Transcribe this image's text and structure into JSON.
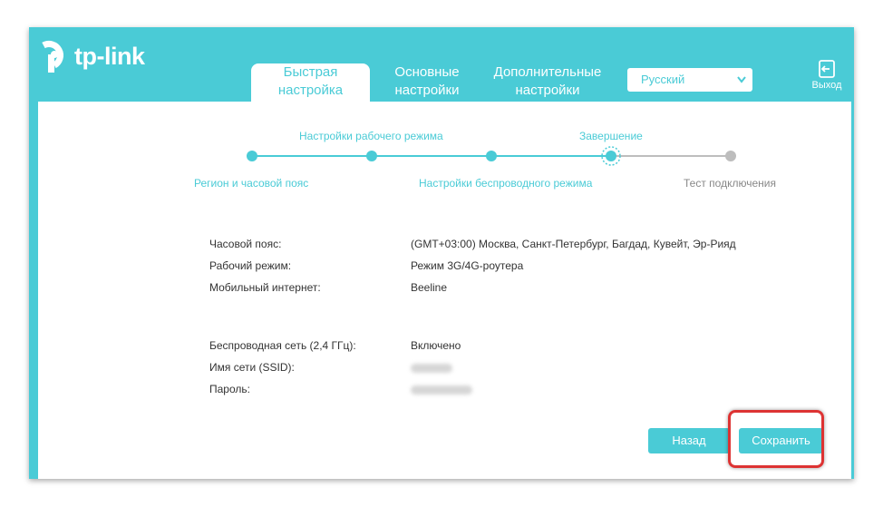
{
  "header": {
    "logo_text": "tp-link",
    "tabs": [
      {
        "line1": "Быстрая",
        "line2": "настройка"
      },
      {
        "line1": "Основные",
        "line2": "настройки"
      },
      {
        "line1": "Дополнительные",
        "line2": "настройки"
      }
    ],
    "language": "Русский",
    "logout_label": "Выход"
  },
  "steps": {
    "top_labels": [
      "Настройки рабочего режима",
      "Завершение"
    ],
    "bottom_labels": [
      "Регион и часовой пояс",
      "Настройки беспроводного режима",
      "Тест подключения"
    ]
  },
  "summary": {
    "rows": [
      {
        "label": "Часовой пояс:",
        "value": "(GMT+03:00) Москва, Санкт-Петербург, Багдад, Кувейт, Эр-Рияд"
      },
      {
        "label": "Рабочий режим:",
        "value": "Режим 3G/4G-роутера"
      },
      {
        "label": "Мобильный интернет:",
        "value": "Beeline"
      },
      {
        "label": "Беспроводная сеть (2,4 ГГц):",
        "value": "Включено"
      },
      {
        "label": "Имя сети (SSID):",
        "value": ""
      },
      {
        "label": "Пароль:",
        "value": ""
      }
    ]
  },
  "buttons": {
    "back": "Назад",
    "save": "Сохранить"
  },
  "colors": {
    "accent": "#4acbd6",
    "highlight": "#dd3333"
  }
}
